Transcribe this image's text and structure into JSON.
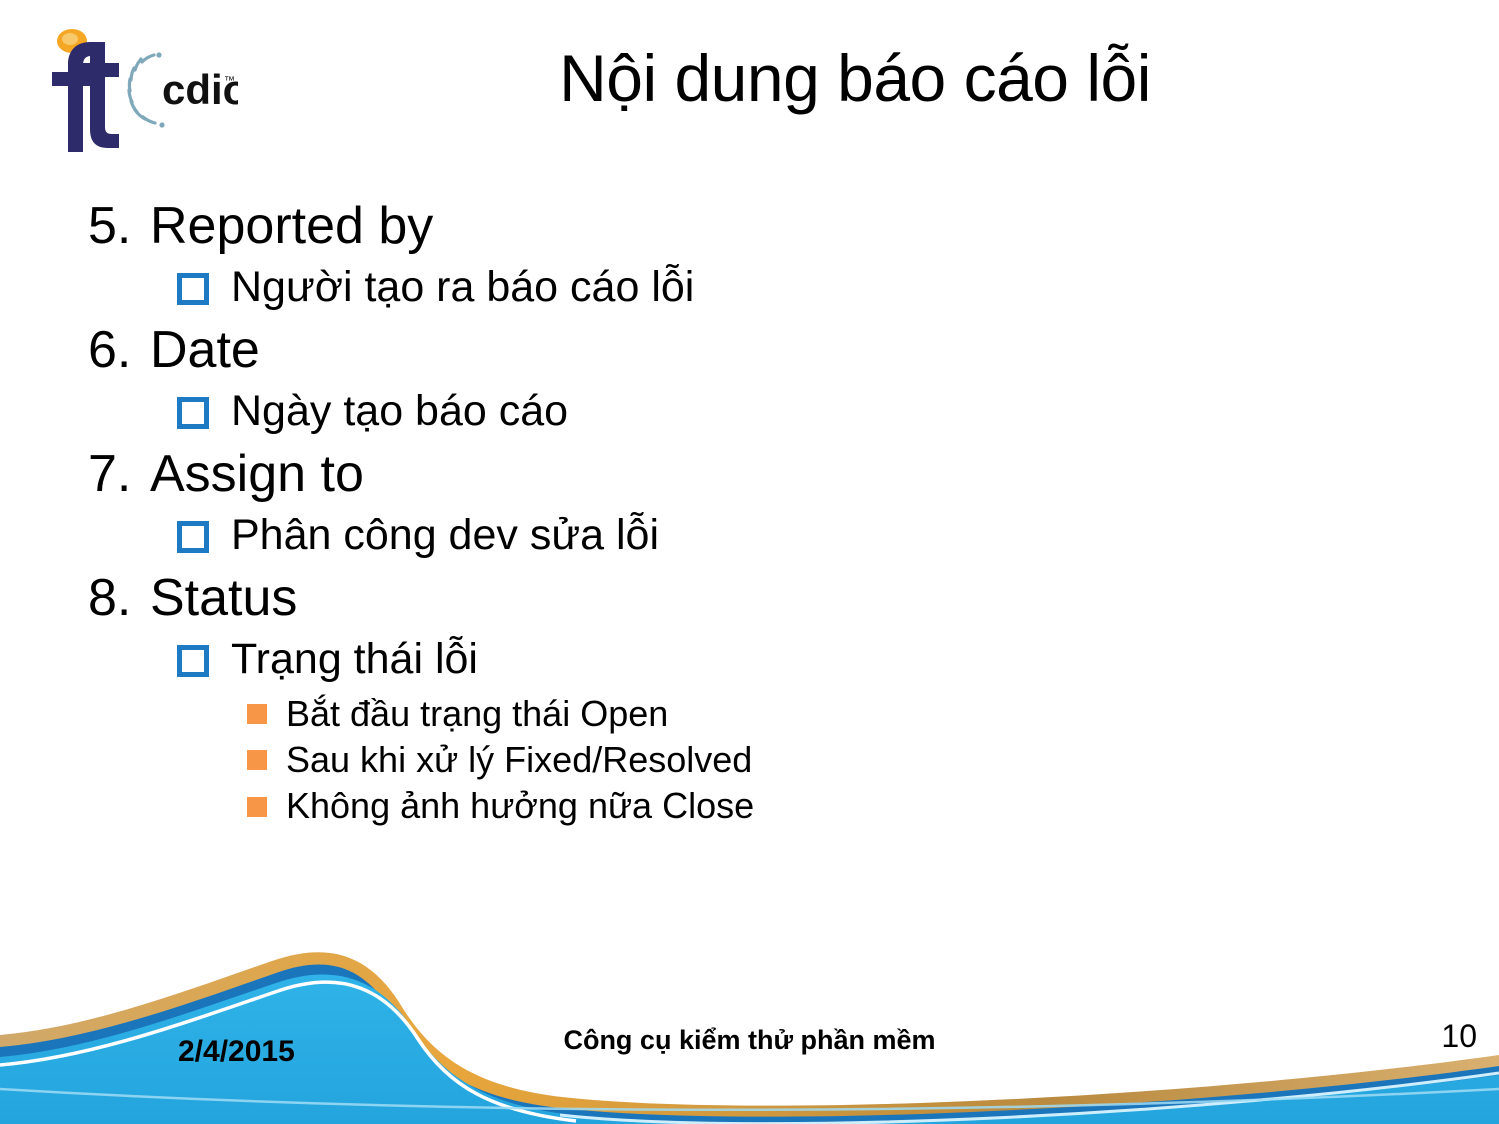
{
  "slide": {
    "title": "Nội dung báo cáo lỗi",
    "logo": {
      "monogram": "ft",
      "wordmark": "cdio",
      "trademark": "™"
    }
  },
  "colors": {
    "bullet_level2": "#1f7ac4",
    "bullet_level3": "#f79646",
    "footer_light_blue": "#29abe2",
    "footer_dark_blue": "#1b75bb",
    "footer_gold": "#c79a4b",
    "logo_navy": "#2e2b6b",
    "logo_orange": "#f5a623"
  },
  "content": {
    "items": [
      {
        "number": "5.",
        "text": "Reported by",
        "sub": [
          {
            "text": "Người tạo ra báo cáo lỗi",
            "sub3": []
          }
        ]
      },
      {
        "number": "6.",
        "text": "Date",
        "sub": [
          {
            "text": "Ngày tạo báo cáo",
            "sub3": []
          }
        ]
      },
      {
        "number": "7.",
        "text": "Assign to",
        "sub": [
          {
            "text": "Phân công dev sửa lỗi",
            "sub3": []
          }
        ]
      },
      {
        "number": "8.",
        "text": "Status",
        "sub": [
          {
            "text": "Trạng thái lỗi",
            "sub3": [
              "Bắt đầu trạng thái Open",
              "Sau khi xử lý Fixed/Resolved",
              "Không ảnh hưởng nữa Close"
            ]
          }
        ]
      }
    ]
  },
  "footer": {
    "date": "2/4/2015",
    "center_text": "Công cụ kiểm thử phần mềm",
    "page_number": "10"
  }
}
